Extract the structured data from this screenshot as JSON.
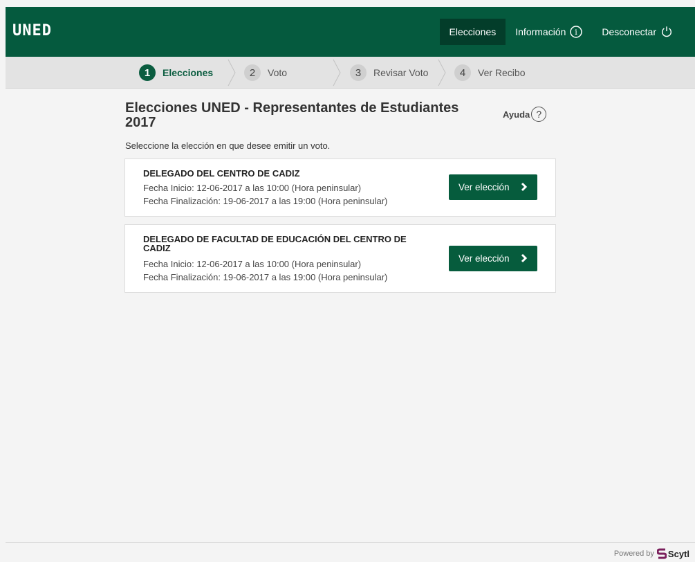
{
  "header": {
    "logo_text": "UNED",
    "nav": {
      "elecciones": "Elecciones",
      "informacion": "Información",
      "desconectar": "Desconectar"
    },
    "brand_color": "#055a3e"
  },
  "steps": [
    {
      "num": "1",
      "label": "Elecciones",
      "active": true
    },
    {
      "num": "2",
      "label": "Voto",
      "active": false
    },
    {
      "num": "3",
      "label": "Revisar Voto",
      "active": false
    },
    {
      "num": "4",
      "label": "Ver Recibo",
      "active": false
    }
  ],
  "main": {
    "title_line1": "Elecciones UNED - Representantes de Estudiantes",
    "title_line2": "2017",
    "help_label": "Ayuda",
    "help_icon": "?",
    "instructions": "Seleccione la elección en que desee emitir un voto."
  },
  "elections": [
    {
      "name": "DELEGADO DEL CENTRO DE CADIZ",
      "start": "Fecha Inicio: 12-06-2017 a las 10:00 (Hora peninsular)",
      "end": "Fecha Finalización: 19-06-2017 a las 19:00 (Hora peninsular)",
      "button": "Ver elección"
    },
    {
      "name": "DELEGADO DE FACULTAD DE EDUCACIÓN DEL CENTRO DE CADIZ",
      "start": "Fecha Inicio: 12-06-2017 a las 10:00 (Hora peninsular)",
      "end": "Fecha Finalización: 19-06-2017 a las 19:00 (Hora peninsular)",
      "button": "Ver elección"
    }
  ],
  "footer": {
    "powered_by": "Powered by",
    "brand": "Scytl"
  }
}
